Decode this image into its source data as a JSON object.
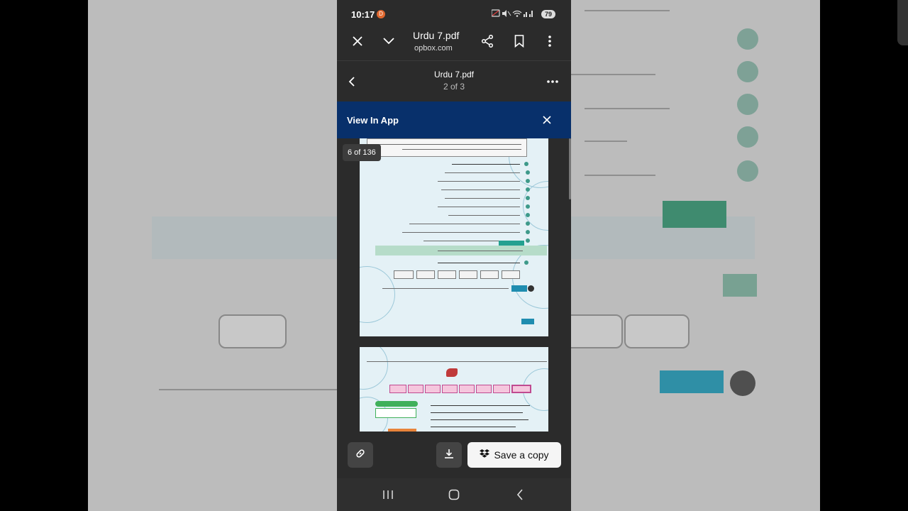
{
  "status_bar": {
    "time": "10:17",
    "notification_badge": "D",
    "battery": "79"
  },
  "app_bar": {
    "title": "Urdu 7.pdf",
    "subtitle": "opbox.com"
  },
  "doc_header": {
    "title": "Urdu 7.pdf",
    "page_info": "2 of 3"
  },
  "banner": {
    "text": "View In App"
  },
  "viewer": {
    "page_counter": "6 of 136"
  },
  "bottom_bar": {
    "save_label": "Save a copy"
  },
  "colors": {
    "app_bg": "#2b2b2b",
    "banner_bg": "#08306b",
    "save_button_bg": "#f5f5f5"
  },
  "icons": [
    "close-icon",
    "chevron-down-icon",
    "share-icon",
    "bookmark-icon",
    "more-vertical-icon",
    "back-icon",
    "more-horizontal-icon",
    "link-icon",
    "download-icon",
    "dropbox-icon",
    "nav-recents-icon",
    "nav-home-icon",
    "nav-back-icon"
  ]
}
